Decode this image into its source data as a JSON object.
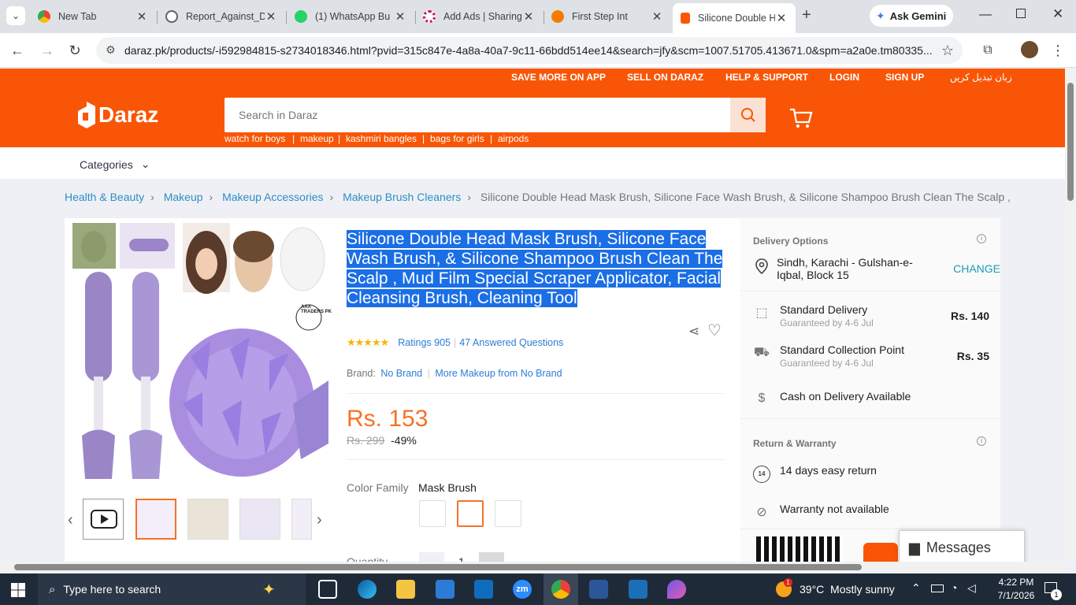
{
  "browser": {
    "tabs": [
      {
        "title": "New Tab",
        "icon": "chrome-icon",
        "color": "#5f6368"
      },
      {
        "title": "Report_Against_D",
        "icon": "globe-icon",
        "color": "#5f6368"
      },
      {
        "title": "(1) WhatsApp Bu",
        "icon": "whatsapp-icon",
        "color": "#25d366"
      },
      {
        "title": "Add Ads | Sharing",
        "icon": "gear-icon",
        "color": "#c2185b"
      },
      {
        "title": "First Step Int",
        "icon": "firststep-icon",
        "color": "#f57c00"
      },
      {
        "title": "Silicone Double H",
        "icon": "daraz-icon",
        "color": "#f85606"
      }
    ],
    "gemini_label": "Ask Gemini",
    "url": "daraz.pk/products/-i592984815-s2734018346.html?pvid=315c847e-4a8a-40a7-9c11-66bdd514ee14&search=jfy&scm=1007.51705.413671.0&spm=a2a0e.tm80335..."
  },
  "header": {
    "logo_text": "Daraz",
    "nav": [
      "SAVE MORE ON APP",
      "SELL ON DARAZ",
      "HELP & SUPPORT",
      "LOGIN",
      "SIGN UP",
      "زبان تبدیل کریں"
    ],
    "search_placeholder": "Search in Daraz",
    "hints": [
      "watch for boys",
      "makeup",
      "kashmiri bangles",
      "bags for girls",
      "airpods"
    ],
    "categories_label": "Categories"
  },
  "breadcrumb": {
    "items": [
      "Health & Beauty",
      "Makeup",
      "Makeup Accessories",
      "Makeup Brush Cleaners"
    ],
    "current": "Silicone Double Head Mask Brush, Silicone Face Wash Brush, & Silicone Shampoo Brush Clean The Scalp ,"
  },
  "product": {
    "title": "Silicone Double Head Mask Brush, Silicone Face Wash Brush, & Silicone Shampoo Brush Clean The Scalp , Mud Film Special Scraper Applicator, Facial Cleansing Brush, Cleaning Tool",
    "rating_stars": 4.5,
    "ratings_label": "Ratings 905",
    "questions_label": "47 Answered Questions",
    "brand_label": "Brand:",
    "brand": "No Brand",
    "more_from": "More Makeup from No Brand",
    "price": "Rs. 153",
    "old_price": "Rs. 299",
    "discount": "-49%",
    "color_family_label": "Color Family",
    "color_family_value": "Mask Brush",
    "quantity_label": "Quantity",
    "quantity": "1",
    "image_badge": "AAA TRADERS PK"
  },
  "delivery": {
    "section_title": "Delivery Options",
    "location": "Sindh, Karachi - Gulshan-e-Iqbal, Block 15",
    "change_label": "CHANGE",
    "options": [
      {
        "title": "Standard Delivery",
        "sub": "Guaranteed by 4-6 Jul",
        "price": "Rs. 140"
      },
      {
        "title": "Standard Collection Point",
        "sub": "Guaranteed by 4-6 Jul",
        "price": "Rs. 35"
      }
    ],
    "cod": "Cash on Delivery Available",
    "return_title": "Return & Warranty",
    "return": "14 days easy return",
    "return_badge": "14",
    "warranty": "Warranty not available"
  },
  "messages_label": "Messages",
  "taskbar": {
    "search_placeholder": "Type here to search",
    "weather": "39°C  Mostly sunny",
    "time": "4:22 PM",
    "date": "7/1/2026",
    "notification_count": "1",
    "weather_badge": "1",
    "zoom_label": "zm"
  }
}
